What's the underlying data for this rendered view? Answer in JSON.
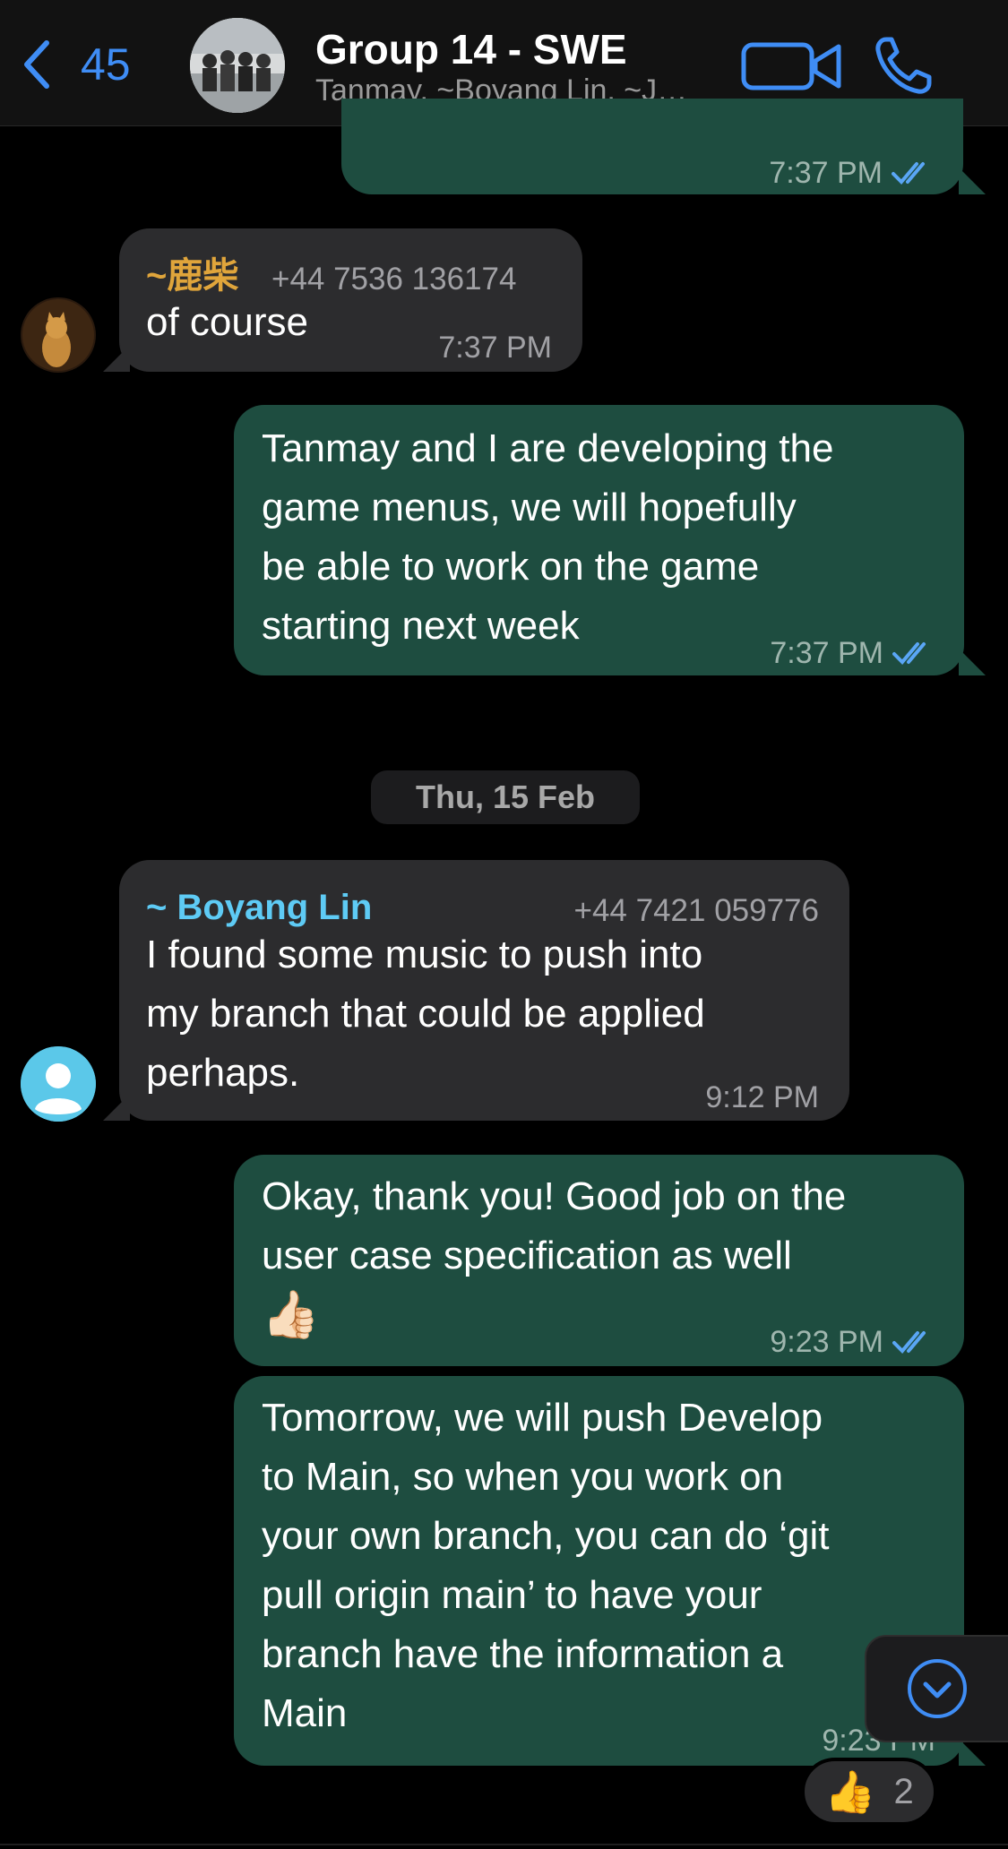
{
  "header": {
    "back_count": "45",
    "title": "Group 14 - SWE",
    "subtitle": "Tanmay, ~Boyang Lin, ~J…",
    "video_icon": "video-camera-icon",
    "call_icon": "phone-icon",
    "accent_color": "#3f8df5"
  },
  "messages": {
    "m0": {
      "time": "7:37 PM",
      "status": "read"
    },
    "m1": {
      "sender": "~鹿柴",
      "phone": "+44 7536 136174",
      "text": "of course",
      "time": "7:37 PM",
      "sender_color": "#e0a53b"
    },
    "m2": {
      "lines": [
        "Tanmay and I are developing the",
        "game menus, we will hopefully",
        "be able to work on the game",
        "starting next week"
      ],
      "time": "7:37 PM",
      "status": "read"
    },
    "date_separator": "Thu, 15 Feb",
    "m3": {
      "sender": "~ Boyang Lin",
      "phone": "+44 7421 059776",
      "lines": [
        "I found some music to push into",
        "my branch that could be applied",
        "perhaps."
      ],
      "time": "9:12 PM",
      "sender_color": "#5ecbf5"
    },
    "m4": {
      "lines": [
        "Okay, thank you! Good job on the",
        "user case specification as well"
      ],
      "emoji": "👍🏻",
      "time": "9:23 PM",
      "status": "read"
    },
    "m5": {
      "lines": [
        "Tomorrow, we will push Develop",
        "to Main, so when you work on",
        "your own branch, you can do ‘git",
        "pull origin main’ to have your",
        "branch have the information a",
        "Main"
      ],
      "time": "9:23 PM"
    },
    "reaction": {
      "emoji": "👍",
      "count": "2"
    }
  },
  "colors": {
    "outgoing_bubble": "#1e4d40",
    "incoming_bubble": "#2c2c2e",
    "read_ticks": "#5aa6f5"
  }
}
